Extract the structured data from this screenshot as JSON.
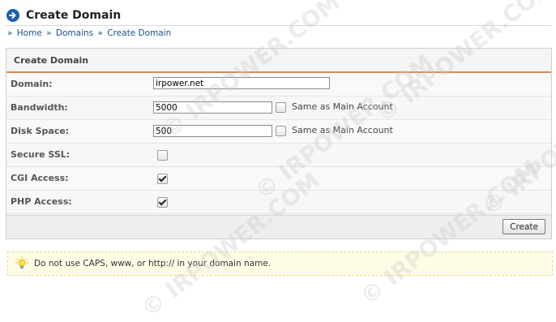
{
  "header": {
    "title": "Create Domain"
  },
  "breadcrumb": {
    "sep": "»",
    "items": [
      "Home",
      "Domains",
      "Create Domain"
    ]
  },
  "panel": {
    "title": "Create Domain",
    "rows": [
      {
        "label": "Domain:",
        "value": "irpower.net"
      },
      {
        "label": "Bandwidth:",
        "value": "5000",
        "same_label": "Same as Main Account",
        "same_checked": false
      },
      {
        "label": "Disk Space:",
        "value": "500",
        "same_label": "Same as Main Account",
        "same_checked": false
      },
      {
        "label": "Secure SSL:",
        "checked": false
      },
      {
        "label": "CGI Access:",
        "checked": true
      },
      {
        "label": "PHP Access:",
        "checked": true
      }
    ],
    "create_label": "Create"
  },
  "tip": {
    "text": "Do not use CAPS, www, or http:// in your domain name."
  },
  "watermark": {
    "text": "© IRPOWER.COM"
  },
  "colors": {
    "accent": "#1e5fa8",
    "rule": "#d98a57",
    "tip_bg": "#fffce6"
  }
}
